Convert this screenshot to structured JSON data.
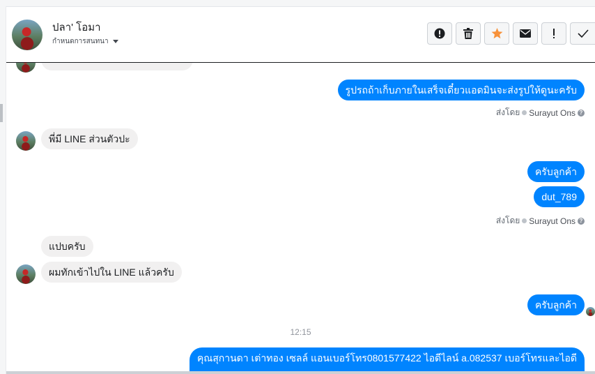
{
  "header": {
    "contact_name": "ปลา' โอมา",
    "assign_label": "กำหนดการสนทนา"
  },
  "toolbar": {
    "buttons": [
      {
        "name": "report-spam-button",
        "icon": "alert-circle-icon"
      },
      {
        "name": "delete-button",
        "icon": "trash-icon"
      },
      {
        "name": "star-button",
        "icon": "star-icon",
        "color": "#f7923b"
      },
      {
        "name": "mark-unread-button",
        "icon": "envelope-icon"
      },
      {
        "name": "follow-up-button",
        "icon": "exclamation-icon"
      },
      {
        "name": "mark-done-button",
        "icon": "check-icon"
      }
    ]
  },
  "colors": {
    "outgoing_bubble": "#0084ff",
    "incoming_bubble": "#f1f0f0",
    "star": "#f7923b"
  },
  "messages": [
    {
      "direction": "out",
      "text": "รูปรถถ้าเก็บภายในเสร็จเดี๋ยวแอดมินจะส่งรูปให้ดูนะครับ"
    },
    {
      "sent_by_label": "ส่งโดย",
      "sender": "Surayut Ons"
    },
    {
      "direction": "in",
      "text": "พี่มี LINE ส่วนตัวปะ"
    },
    {
      "direction": "out",
      "text": "ครับลูกค้า"
    },
    {
      "direction": "out",
      "text": "dut_789"
    },
    {
      "sent_by_label": "ส่งโดย",
      "sender": "Surayut Ons"
    },
    {
      "direction": "in",
      "text": "แปบครับ"
    },
    {
      "direction": "in",
      "text": "ผมทักเข้าไปใน LINE แล้วครับ"
    },
    {
      "direction": "out",
      "text": "ครับลูกค้า"
    },
    {
      "time": "12:15"
    },
    {
      "direction": "out",
      "text": "คุณสุกานดา เต่าทอง  เซลล์ แอนเบอร์โทร0801577422 ไอดีไลน์ a.082537  เบอร์โทรและไอดี"
    }
  ]
}
